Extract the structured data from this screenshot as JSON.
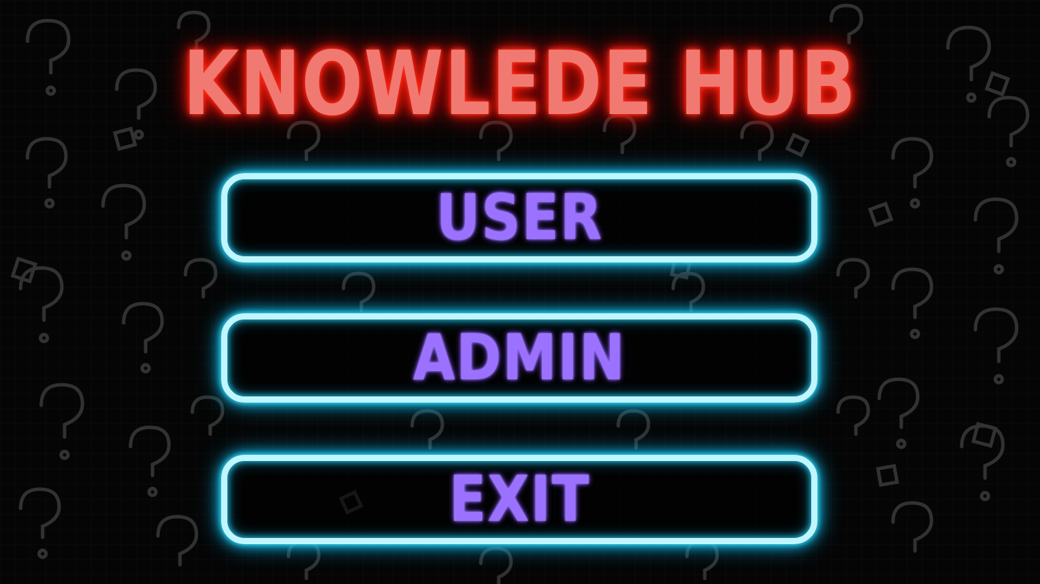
{
  "title": "KNOWLEDE HUB",
  "menu": {
    "user_label": "USER",
    "admin_label": "ADMIN",
    "exit_label": "EXIT"
  },
  "background": {
    "pattern_icon": "question-mark-icon",
    "base_color": "#050505"
  },
  "colors": {
    "title_fill": "#f07a72",
    "title_glow": "#ff2a1a",
    "button_border": "#bff6ff",
    "button_glow": "#18c6f0",
    "button_text": "#9a72ff"
  }
}
